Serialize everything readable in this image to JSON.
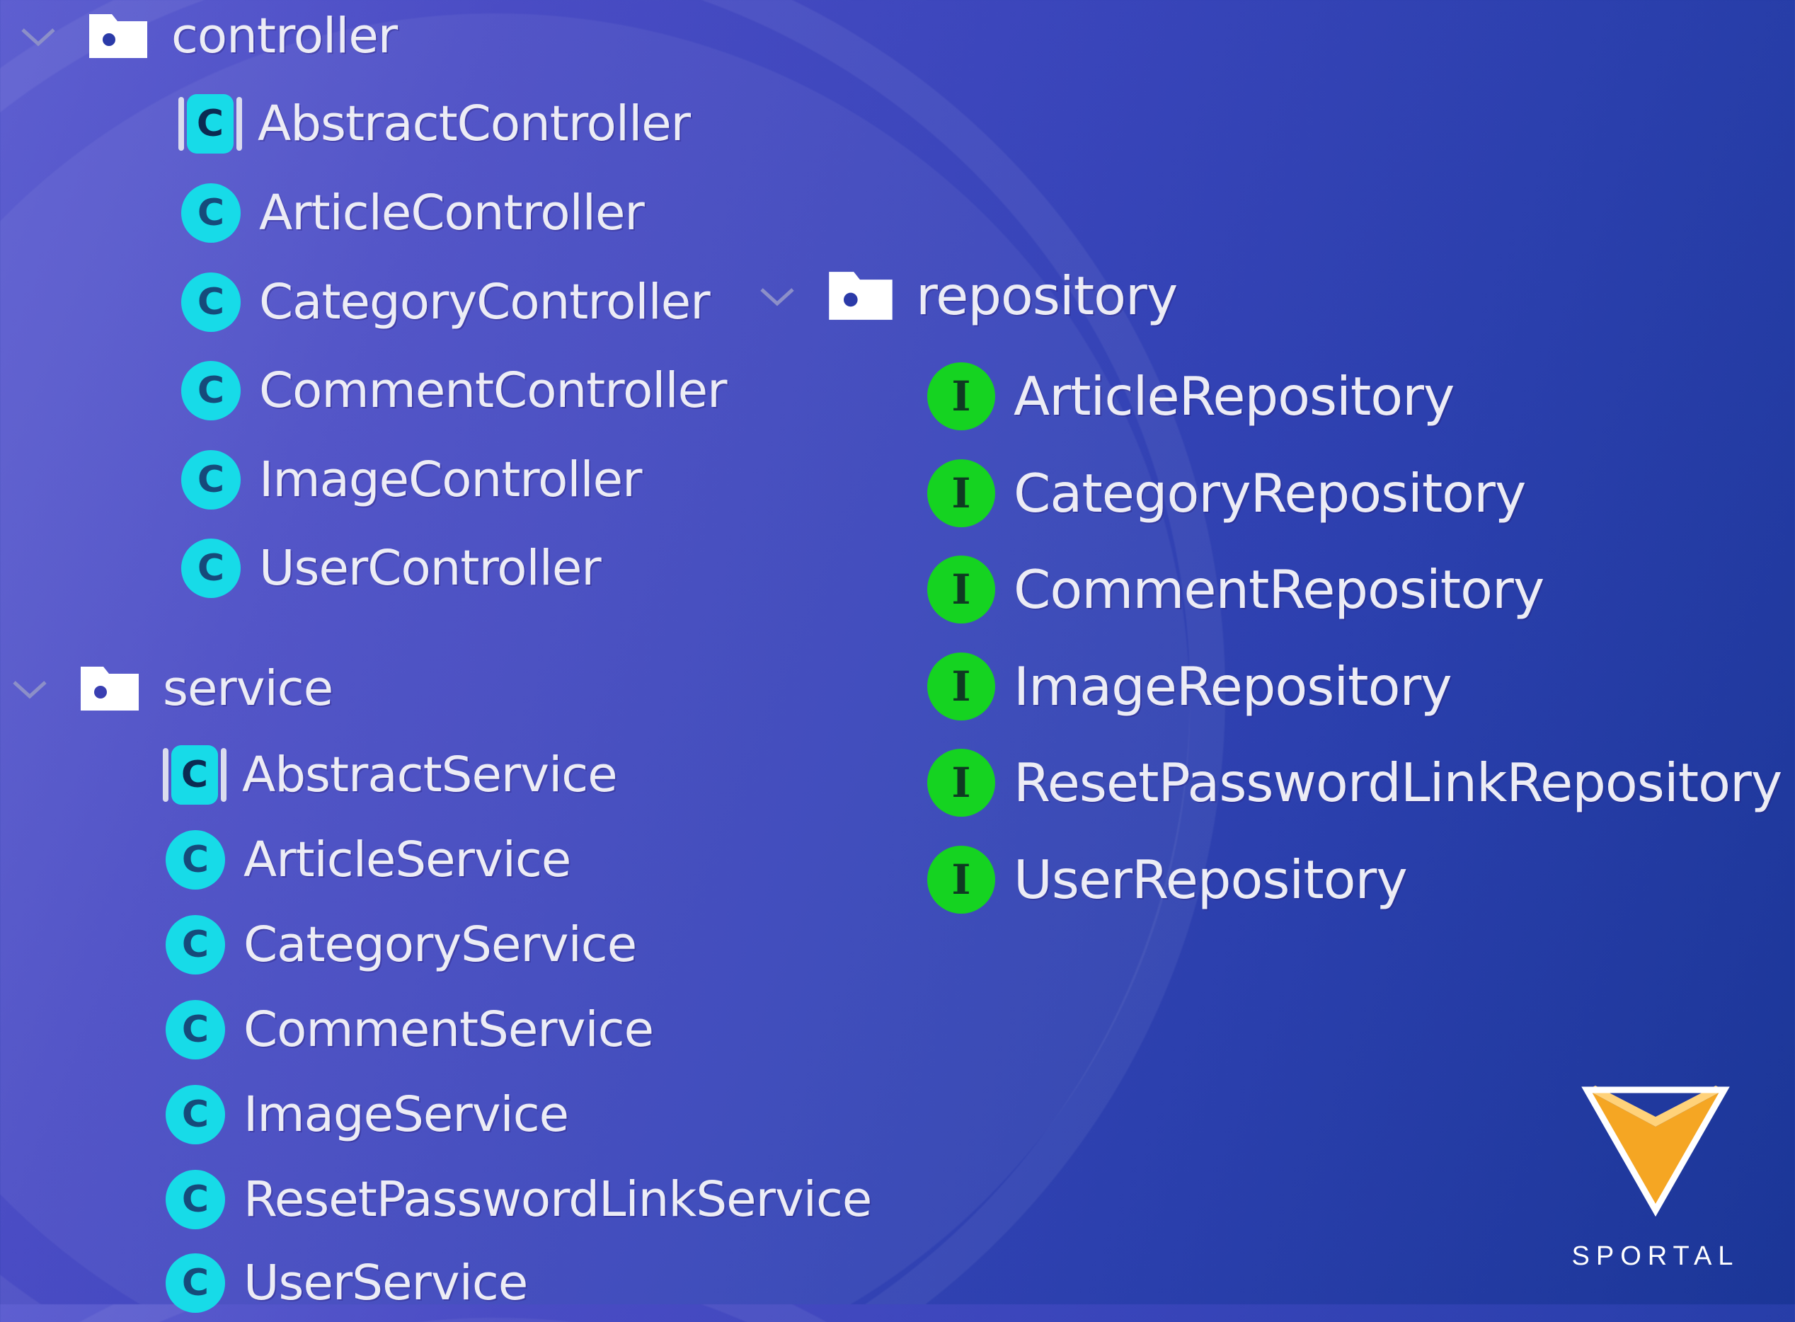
{
  "colors": {
    "class_icon": "#17dbe8",
    "interface_icon": "#15d321",
    "logo_orange": "#f5a623",
    "logo_outline": "#ffffff"
  },
  "controller": {
    "folder_label": "controller",
    "items": [
      {
        "label": "AbstractController",
        "kind": "abstract-class",
        "glyph": "C"
      },
      {
        "label": "ArticleController",
        "kind": "class",
        "glyph": "C"
      },
      {
        "label": "CategoryController",
        "kind": "class",
        "glyph": "C"
      },
      {
        "label": "CommentController",
        "kind": "class",
        "glyph": "C"
      },
      {
        "label": "ImageController",
        "kind": "class",
        "glyph": "C"
      },
      {
        "label": "UserController",
        "kind": "class",
        "glyph": "C"
      }
    ]
  },
  "service": {
    "folder_label": "service",
    "items": [
      {
        "label": "AbstractService",
        "kind": "abstract-class",
        "glyph": "C"
      },
      {
        "label": "ArticleService",
        "kind": "class",
        "glyph": "C"
      },
      {
        "label": "CategoryService",
        "kind": "class",
        "glyph": "C"
      },
      {
        "label": "CommentService",
        "kind": "class",
        "glyph": "C"
      },
      {
        "label": "ImageService",
        "kind": "class",
        "glyph": "C"
      },
      {
        "label": "ResetPasswordLinkService",
        "kind": "class",
        "glyph": "C"
      },
      {
        "label": "UserService",
        "kind": "class",
        "glyph": "C"
      }
    ]
  },
  "repository": {
    "folder_label": "repository",
    "items": [
      {
        "label": "ArticleRepository",
        "kind": "interface",
        "glyph": "I"
      },
      {
        "label": "CategoryRepository",
        "kind": "interface",
        "glyph": "I"
      },
      {
        "label": "CommentRepository",
        "kind": "interface",
        "glyph": "I"
      },
      {
        "label": "ImageRepository",
        "kind": "interface",
        "glyph": "I"
      },
      {
        "label": "ResetPasswordLinkRepository",
        "kind": "interface",
        "glyph": "I"
      },
      {
        "label": "UserRepository",
        "kind": "interface",
        "glyph": "I"
      }
    ]
  },
  "logo": {
    "text": "SPORTAL",
    "icon": "v-chevron-logo"
  }
}
